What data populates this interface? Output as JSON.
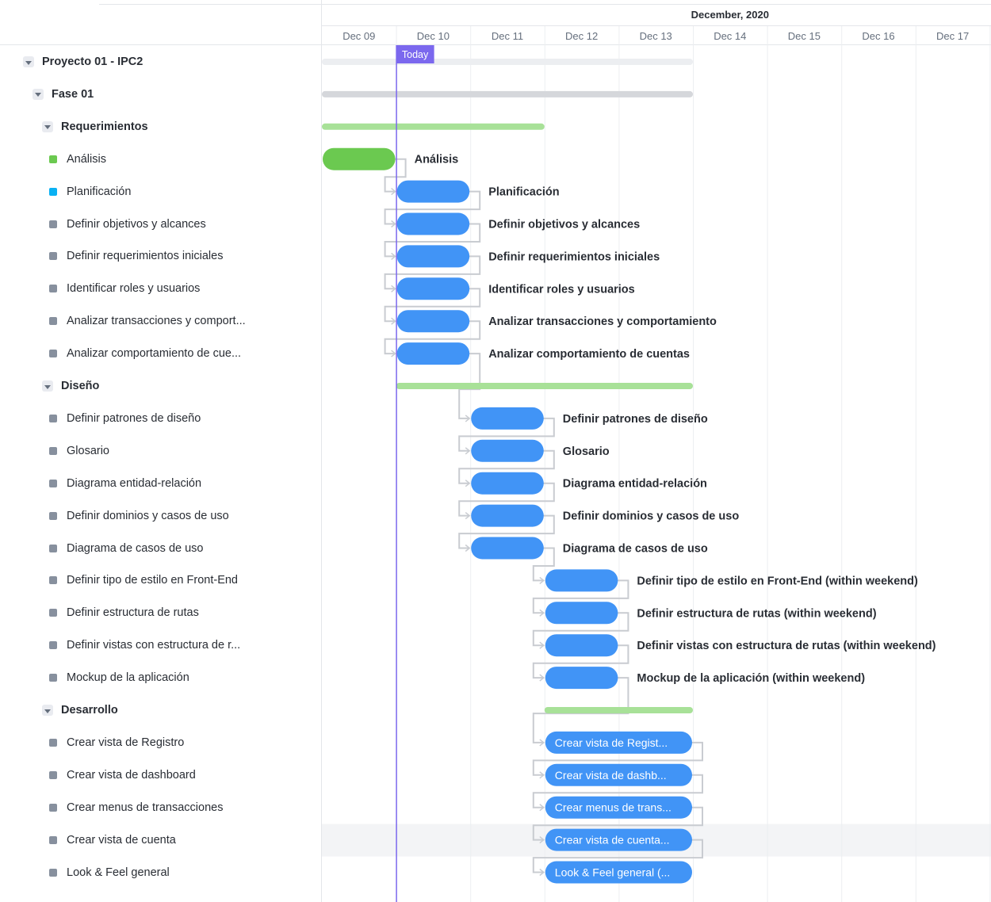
{
  "timeline": {
    "month_label": "December, 2020",
    "days": [
      "Dec 09",
      "Dec 10",
      "Dec 11",
      "Dec 12",
      "Dec 13",
      "Dec 14",
      "Dec 15",
      "Dec 16",
      "Dec 17"
    ],
    "today_label": "Today",
    "today_day": 1.0
  },
  "colors": {
    "bar_blue": "#4194f6",
    "bar_green": "#6bc950",
    "phase_green": "#a8e198",
    "summary_gray": "#d5d7db",
    "today_purple": "#7b68ee",
    "dot_gray": "#87909e",
    "dot_blue": "#0ab1f3"
  },
  "rows": [
    {
      "kind": "group",
      "level": 0,
      "label": "Proyecto 01 - IPC2",
      "summary": {
        "start": 0,
        "end": 5,
        "color": "light"
      }
    },
    {
      "kind": "group",
      "level": 1,
      "label": "Fase 01",
      "summary": {
        "start": 0,
        "end": 5,
        "color": "gray"
      }
    },
    {
      "kind": "group",
      "level": 2,
      "label": "Requerimientos",
      "summary": {
        "start": 0,
        "end": 3,
        "color": "green"
      }
    },
    {
      "kind": "task",
      "label": "Análisis",
      "status": "green",
      "bar": {
        "start": 0,
        "end": 1,
        "color": "green"
      },
      "bar_label": "Análisis"
    },
    {
      "kind": "task",
      "label": "Planificación",
      "status": "blue",
      "bar": {
        "start": 1,
        "end": 2
      },
      "bar_label": "Planificación"
    },
    {
      "kind": "task",
      "label": "Definir objetivos y alcances",
      "status": "gray",
      "bar": {
        "start": 1,
        "end": 2
      },
      "bar_label": "Definir objetivos y alcances"
    },
    {
      "kind": "task",
      "label": "Definir requerimientos iniciales",
      "status": "gray",
      "bar": {
        "start": 1,
        "end": 2
      },
      "bar_label": "Definir requerimientos iniciales"
    },
    {
      "kind": "task",
      "label": "Identificar roles y usuarios",
      "status": "gray",
      "bar": {
        "start": 1,
        "end": 2
      },
      "bar_label": "Identificar roles y usuarios"
    },
    {
      "kind": "task",
      "label": "Analizar transacciones y comport...",
      "status": "gray",
      "bar": {
        "start": 1,
        "end": 2
      },
      "bar_label": "Analizar transacciones y comportamiento"
    },
    {
      "kind": "task",
      "label": "Analizar comportamiento de cue...",
      "status": "gray",
      "bar": {
        "start": 1,
        "end": 2
      },
      "bar_label": "Analizar comportamiento de cuentas"
    },
    {
      "kind": "group",
      "level": 2,
      "label": "Diseño",
      "summary": {
        "start": 1,
        "end": 5,
        "color": "green"
      }
    },
    {
      "kind": "task",
      "label": "Definir patrones de diseño",
      "status": "gray",
      "bar": {
        "start": 2,
        "end": 3
      },
      "bar_label": "Definir patrones de diseño"
    },
    {
      "kind": "task",
      "label": "Glosario",
      "status": "gray",
      "bar": {
        "start": 2,
        "end": 3
      },
      "bar_label": "Glosario"
    },
    {
      "kind": "task",
      "label": "Diagrama entidad-relación",
      "status": "gray",
      "bar": {
        "start": 2,
        "end": 3
      },
      "bar_label": "Diagrama entidad-relación"
    },
    {
      "kind": "task",
      "label": "Definir dominios y casos de uso",
      "status": "gray",
      "bar": {
        "start": 2,
        "end": 3
      },
      "bar_label": "Definir dominios y casos de uso"
    },
    {
      "kind": "task",
      "label": "Diagrama de casos de uso",
      "status": "gray",
      "bar": {
        "start": 2,
        "end": 3
      },
      "bar_label": "Diagrama de casos de uso"
    },
    {
      "kind": "task",
      "label": "Definir tipo de estilo en Front-End",
      "status": "gray",
      "bar": {
        "start": 3,
        "end": 4
      },
      "bar_label": "Definir tipo de estilo en Front-End (within weekend)"
    },
    {
      "kind": "task",
      "label": "Definir estructura de rutas",
      "status": "gray",
      "bar": {
        "start": 3,
        "end": 4
      },
      "bar_label": "Definir estructura de rutas (within weekend)"
    },
    {
      "kind": "task",
      "label": "Definir vistas con estructura de r...",
      "status": "gray",
      "bar": {
        "start": 3,
        "end": 4
      },
      "bar_label": "Definir vistas con estructura de rutas (within weekend)"
    },
    {
      "kind": "task",
      "label": "Mockup de la aplicación",
      "status": "gray",
      "bar": {
        "start": 3,
        "end": 4
      },
      "bar_label": "Mockup de la aplicación (within weekend)"
    },
    {
      "kind": "group",
      "level": 2,
      "label": "Desarrollo",
      "summary": {
        "start": 3,
        "end": 5,
        "color": "green"
      }
    },
    {
      "kind": "task",
      "label": "Crear vista de Registro",
      "status": "gray",
      "bar": {
        "start": 3,
        "end": 5,
        "inner": "Crear vista de Regist..."
      }
    },
    {
      "kind": "task",
      "label": "Crear vista de dashboard",
      "status": "gray",
      "bar": {
        "start": 3,
        "end": 5,
        "inner": "Crear vista de dashb..."
      }
    },
    {
      "kind": "task",
      "label": "Crear menus de transacciones",
      "status": "gray",
      "bar": {
        "start": 3,
        "end": 5,
        "inner": "Crear menus de trans..."
      }
    },
    {
      "kind": "task",
      "label": "Crear vista de cuenta",
      "status": "gray",
      "bar": {
        "start": 3,
        "end": 5,
        "inner": "Crear vista de cuenta..."
      },
      "highlight": true
    },
    {
      "kind": "task",
      "label": "Look & Feel general",
      "status": "gray",
      "bar": {
        "start": 3,
        "end": 5,
        "inner": "Look & Feel general (..."
      }
    }
  ]
}
